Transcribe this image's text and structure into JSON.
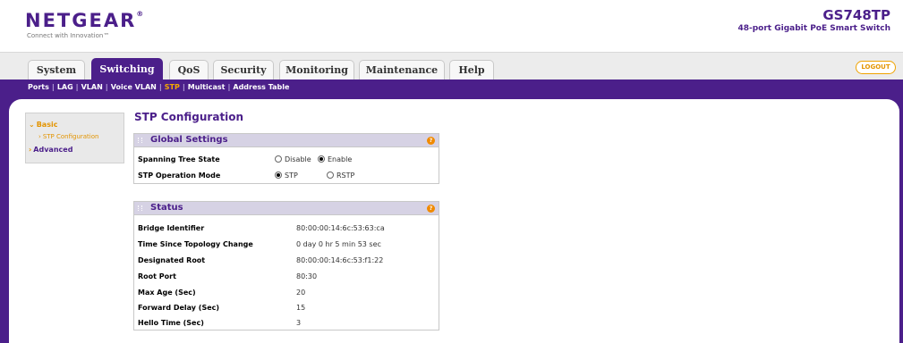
{
  "header": {
    "logo": "NETGEAR",
    "logo_reg": "®",
    "tagline": "Connect with Innovation™",
    "model": "GS748TP",
    "model_desc": "48-port Gigabit PoE Smart Switch"
  },
  "tabs": [
    {
      "label": "System"
    },
    {
      "label": "Switching"
    },
    {
      "label": "QoS"
    },
    {
      "label": "Security"
    },
    {
      "label": "Monitoring"
    },
    {
      "label": "Maintenance"
    },
    {
      "label": "Help"
    }
  ],
  "active_tab": "Switching",
  "logout_label": "LOGOUT",
  "subnav": [
    {
      "label": "Ports"
    },
    {
      "label": "LAG"
    },
    {
      "label": "VLAN"
    },
    {
      "label": "Voice VLAN"
    },
    {
      "label": "STP"
    },
    {
      "label": "Multicast"
    },
    {
      "label": "Address Table"
    }
  ],
  "subnav_sep": "|",
  "leftnav": {
    "basic": "Basic",
    "stp_config": "STP Configuration",
    "advanced": "Advanced"
  },
  "page_title": "STP Configuration",
  "global_settings": {
    "title": "Global Settings",
    "spanning_tree_state_label": "Spanning Tree State",
    "disable_label": "Disable",
    "enable_label": "Enable",
    "state_value": "Enable",
    "operation_mode_label": "STP Operation Mode",
    "stp_label": "STP",
    "rstp_label": "RSTP",
    "mode_value": "STP"
  },
  "status": {
    "title": "Status",
    "rows": [
      {
        "label": "Bridge Identifier",
        "value": "80:00:00:14:6c:53:63:ca"
      },
      {
        "label": "Time Since Topology Change",
        "value": "0 day 0 hr 5 min 53 sec"
      },
      {
        "label": "Designated Root",
        "value": "80:00:00:14:6c:53:f1:22"
      },
      {
        "label": "Root Port",
        "value": "80:30"
      },
      {
        "label": "Max Age (Sec)",
        "value": "20"
      },
      {
        "label": "Forward Delay (Sec)",
        "value": "15"
      },
      {
        "label": "Hello Time (Sec)",
        "value": "3"
      }
    ]
  },
  "help_icon_glyph": "?",
  "arrow_glyph": "›",
  "colors": {
    "brand_purple": "#4b1f8a",
    "accent_orange": "#e39400",
    "panel_header": "#d6d2e4"
  }
}
